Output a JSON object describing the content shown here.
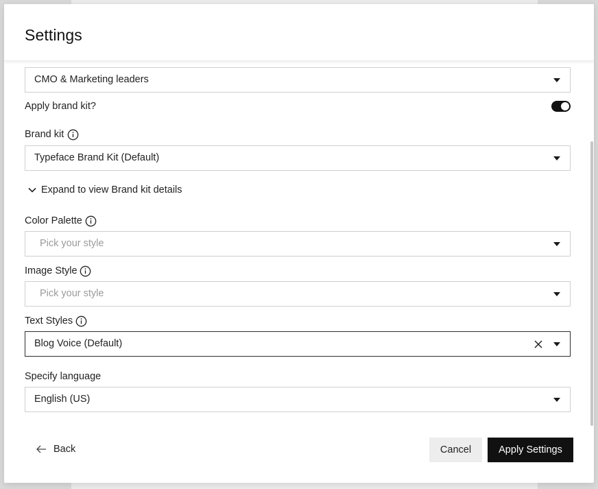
{
  "modal": {
    "title": "Settings"
  },
  "audience": {
    "value": "CMO & Marketing leaders"
  },
  "brand_kit_toggle": {
    "label": "Apply brand kit?",
    "on": true
  },
  "brand_kit": {
    "label": "Brand kit",
    "value": "Typeface Brand Kit (Default)",
    "expand_label": "Expand to view Brand kit details"
  },
  "color_palette": {
    "label": "Color Palette",
    "placeholder": "Pick your style"
  },
  "image_style": {
    "label": "Image Style",
    "placeholder": "Pick your style"
  },
  "text_styles": {
    "label": "Text Styles",
    "value": "Blog Voice (Default)"
  },
  "language": {
    "label": "Specify language",
    "value": "English (US)"
  },
  "footer": {
    "back_label": "Back",
    "cancel_label": "Cancel",
    "apply_label": "Apply Settings"
  },
  "icons": {
    "info": "info-icon",
    "caret": "chevron-down-icon",
    "clear": "close-icon",
    "back": "arrow-left-icon",
    "expand": "chevron-down-icon"
  },
  "colors": {
    "primary": "#111111",
    "border": "#cfcfcf",
    "placeholder": "#9b9b9b",
    "cancel_bg": "#ededed"
  }
}
